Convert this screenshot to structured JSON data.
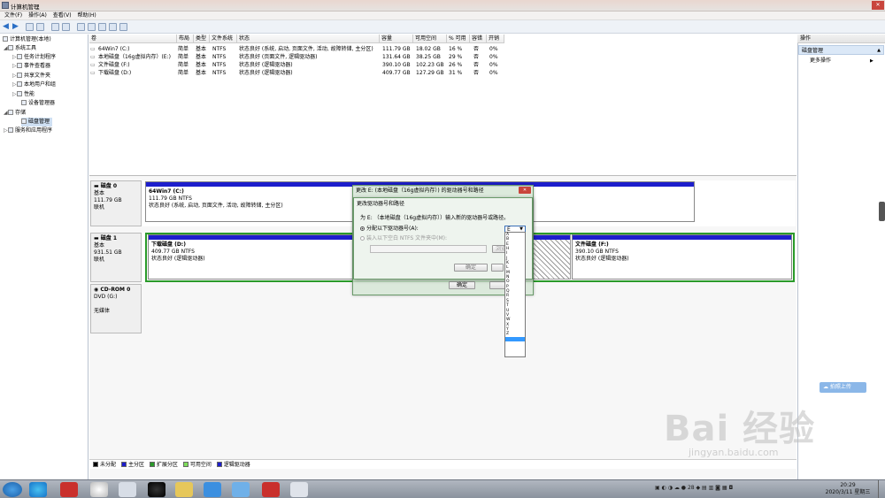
{
  "window": {
    "title": "计算机管理"
  },
  "menu": [
    "文件(F)",
    "操作(A)",
    "查看(V)",
    "帮助(H)"
  ],
  "tree": [
    {
      "label": "计算机管理(本地)",
      "icon": "computer-icon"
    },
    {
      "label": "系统工具",
      "icon": "tools-icon"
    },
    {
      "label": "任务计划程序",
      "icon": "clock-icon"
    },
    {
      "label": "事件查看器",
      "icon": "event-icon"
    },
    {
      "label": "共享文件夹",
      "icon": "folder-icon"
    },
    {
      "label": "本地用户和组",
      "icon": "users-icon"
    },
    {
      "label": "性能",
      "icon": "performance-icon"
    },
    {
      "label": "设备管理器",
      "icon": "device-icon"
    },
    {
      "label": "存储",
      "icon": "storage-icon"
    },
    {
      "label": "磁盘管理",
      "icon": "disk-icon"
    },
    {
      "label": "服务和应用程序",
      "icon": "services-icon"
    }
  ],
  "volumes": {
    "columns": [
      "卷",
      "布局",
      "类型",
      "文件系统",
      "状态",
      "容量",
      "可用空间",
      "% 可用",
      "容错",
      "开销"
    ],
    "rows": [
      [
        "64Win7 (C:)",
        "简单",
        "基本",
        "NTFS",
        "状态良好 (系统, 启动, 页面文件, 活动, 故障转储, 主分区)",
        "111.79 GB",
        "18.02 GB",
        "16 %",
        "否",
        "0%"
      ],
      [
        "本地磁盘（16g虚拟内存）(E:)",
        "简单",
        "基本",
        "NTFS",
        "状态良好 (页面文件, 逻辑驱动器)",
        "131.64 GB",
        "38.25 GB",
        "29 %",
        "否",
        "0%"
      ],
      [
        "文件磁盘 (F:)",
        "简单",
        "基本",
        "NTFS",
        "状态良好 (逻辑驱动器)",
        "390.10 GB",
        "102.23 GB",
        "26 %",
        "否",
        "0%"
      ],
      [
        "下载磁盘 (D:)",
        "简单",
        "基本",
        "NTFS",
        "状态良好 (逻辑驱动器)",
        "409.77 GB",
        "127.29 GB",
        "31 %",
        "否",
        "0%"
      ]
    ]
  },
  "disks": {
    "disk0": {
      "name": "磁盘 0",
      "type": "基本",
      "size": "111.79 GB",
      "state": "联机",
      "part": {
        "name": "64Win7  (C:)",
        "size": "111.79 GB NTFS",
        "status": "状态良好 (系统, 启动, 页面文件, 活动, 故障转储, 主分区)"
      }
    },
    "disk1": {
      "name": "磁盘 1",
      "type": "基本",
      "size": "931.51 GB",
      "state": "联机",
      "partD": {
        "name": "下载磁盘  (D:)",
        "size": "409.77 GB NTFS",
        "status": "状态良好 (逻辑驱动器)"
      },
      "partF": {
        "name": "文件磁盘  (F:)",
        "size": "390.10 GB NTFS",
        "status": "状态良好 (逻辑驱动器)"
      }
    },
    "cdrom": {
      "name": "CD-ROM 0",
      "type": "DVD (G:)",
      "state": "无媒体"
    }
  },
  "legend": [
    "未分配",
    "主分区",
    "扩展分区",
    "可用空间",
    "逻辑驱动器"
  ],
  "legend_colors": [
    "#000000",
    "#1d1ecc",
    "#2a9a2a",
    "#7ddc5a",
    "#1d1ecc"
  ],
  "actions": {
    "header": "操作",
    "section": "磁盘管理",
    "more": "更多操作"
  },
  "dialog_outer": {
    "title": "更改 E: (本地磁盘（16g虚拟内存）) 的驱动器号和路径",
    "ok": "确定"
  },
  "dialog_inner": {
    "title": "更改驱动器号和路径",
    "prompt": "为 E: （本地磁盘（16g虚拟内存））输入新的驱动器号或路径。",
    "option1": "分配以下驱动器号(A):",
    "option2": "装入以下空白 NTFS 文件夹中(M):",
    "selected_letter": "E",
    "browse": "浏览",
    "ok": "确定"
  },
  "letters": [
    "A",
    "B",
    "E",
    "H",
    "I",
    "J",
    "K",
    "L",
    "M",
    "N",
    "O",
    "P",
    "Q",
    "R",
    "S",
    "T",
    "U",
    "V",
    "W",
    "X",
    "Y",
    "Z",
    ""
  ],
  "upload": "拍照上传",
  "watermark": {
    "brand": "Bai 经验",
    "site": "jingyan.baidu.com"
  },
  "clock": {
    "time": "20:29",
    "date": "2020/3/11 星期三"
  },
  "tray_number": "28"
}
